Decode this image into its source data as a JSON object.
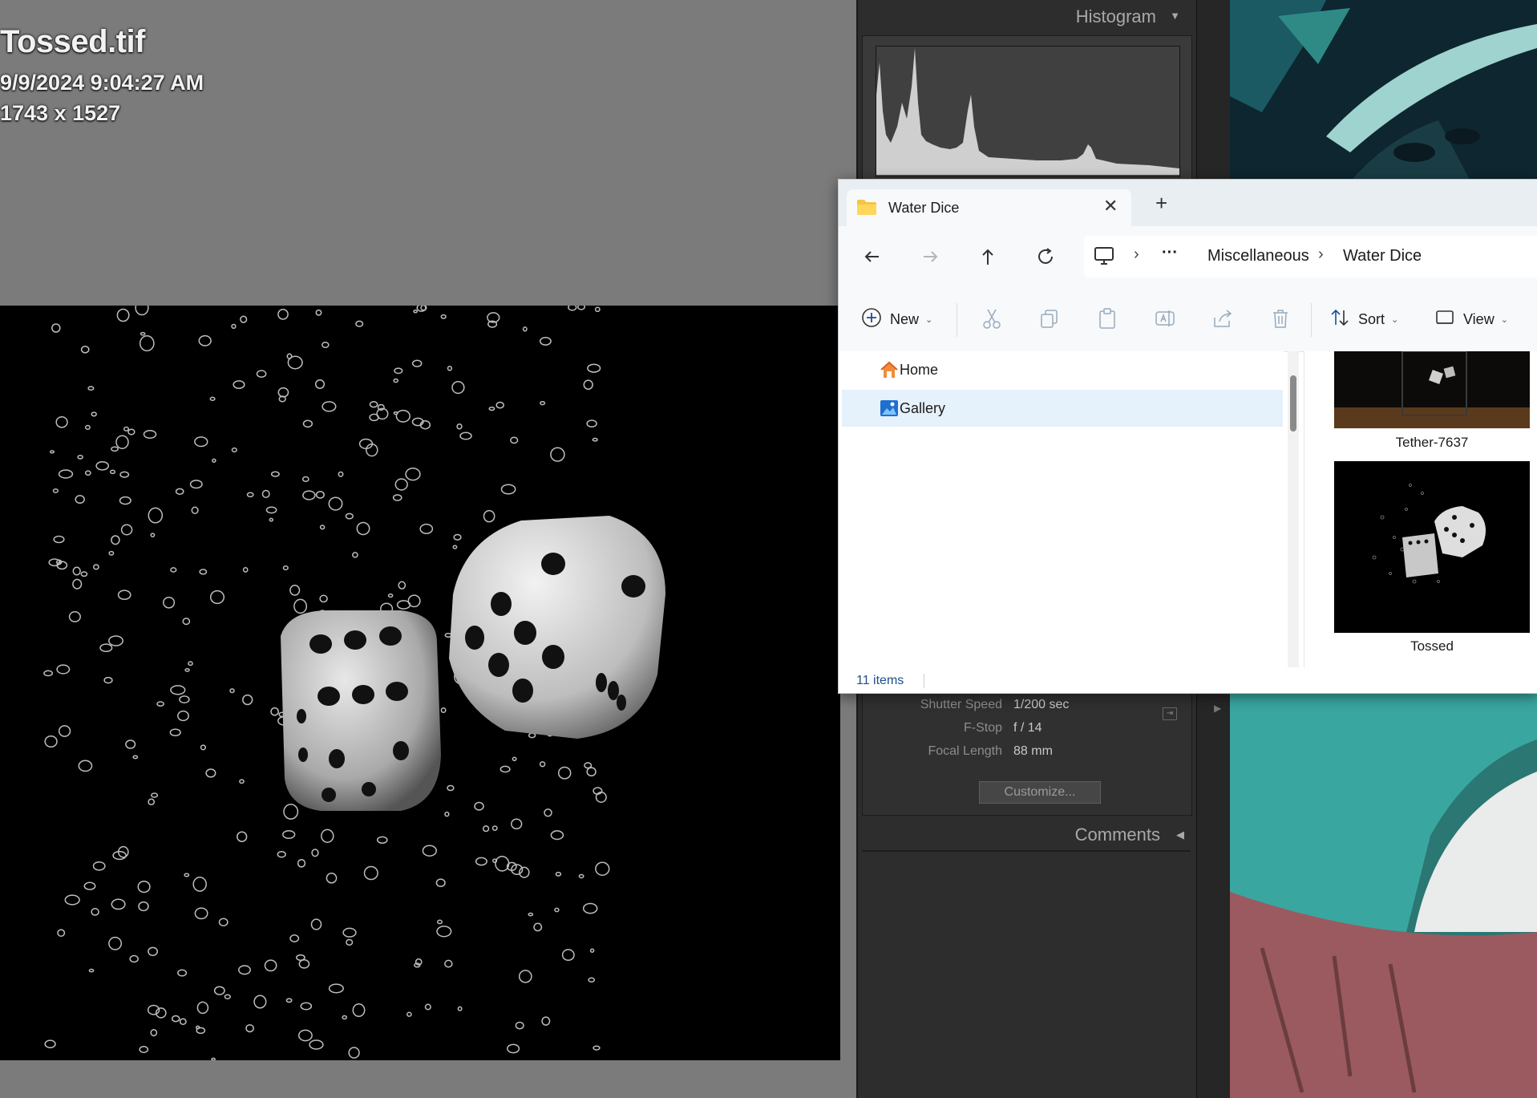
{
  "loupe": {
    "filename": "Tossed.tif",
    "capture_datetime": "9/9/2024 9:04:27 AM",
    "dimensions": "1743 x 1527"
  },
  "right_panel": {
    "histogram_title": "Histogram",
    "histogram_collapse_icon": "triangle-down-icon",
    "metadata": [
      {
        "label": "Shutter Speed",
        "value": "1/200 sec"
      },
      {
        "label": "F-Stop",
        "value": "f / 14"
      },
      {
        "label": "Focal Length",
        "value": "88 mm"
      }
    ],
    "customize_label": "Customize...",
    "comments_title": "Comments",
    "comments_expand_icon": "triangle-left-icon"
  },
  "explorer": {
    "tab_title": "Water Dice",
    "tab_icon": "folder-icon",
    "new_tab_icon": "plus-icon",
    "breadcrumb": {
      "root_icon": "this-pc-icon",
      "overflow": "···",
      "items": [
        "Miscellaneous",
        "Water Dice"
      ]
    },
    "toolbar": {
      "new_label": "New",
      "sort_label": "Sort",
      "view_label": "View"
    },
    "nav": [
      {
        "label": "Home",
        "icon": "home-icon"
      },
      {
        "label": "Gallery",
        "icon": "gallery-icon"
      }
    ],
    "files": [
      {
        "name": "Tether-7637"
      },
      {
        "name": "Tossed"
      }
    ],
    "status_items": "11 items"
  },
  "colors": {
    "accent_blue": "#1f4e8c",
    "selection": "#e5f1fb",
    "folder_yellow": "#f4c542",
    "lr_panel": "#2d2d2d"
  }
}
